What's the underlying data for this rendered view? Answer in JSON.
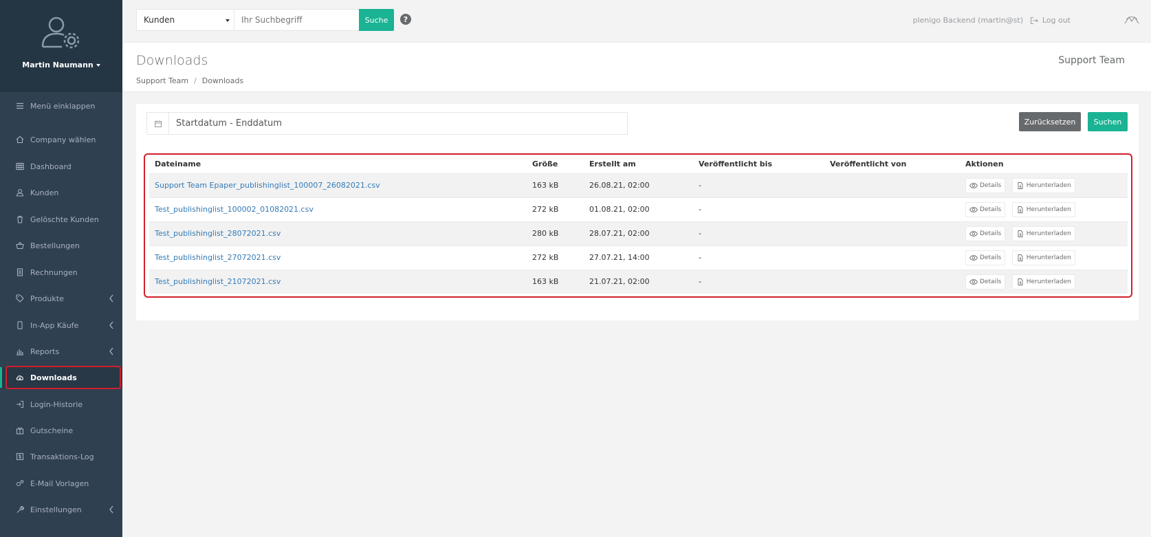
{
  "sidebar": {
    "user_name": "Martin Naumann",
    "items": [
      {
        "label": "Menü einklappen",
        "icon": "bars-icon"
      },
      {
        "label": "Company wählen",
        "icon": "home-icon"
      },
      {
        "label": "Dashboard",
        "icon": "table-icon"
      },
      {
        "label": "Kunden",
        "icon": "user-icon"
      },
      {
        "label": "Gelöschte Kunden",
        "icon": "trash-icon"
      },
      {
        "label": "Bestellungen",
        "icon": "basket-icon"
      },
      {
        "label": "Rechnungen",
        "icon": "invoice-icon"
      },
      {
        "label": "Produkte",
        "icon": "tag-icon"
      },
      {
        "label": "In-App Käufe",
        "icon": "mobile-icon"
      },
      {
        "label": "Reports",
        "icon": "bar-chart-icon"
      },
      {
        "label": "Downloads",
        "icon": "cloud-download-icon"
      },
      {
        "label": "Login-Historie",
        "icon": "sign-in-icon"
      },
      {
        "label": "Gutscheine",
        "icon": "gift-icon"
      },
      {
        "label": "Transaktions-Log",
        "icon": "dollar-icon"
      },
      {
        "label": "E-Mail Vorlagen",
        "icon": "cogs-icon"
      },
      {
        "label": "Einstellungen",
        "icon": "wrench-icon"
      }
    ]
  },
  "topbar": {
    "select_value": "Kunden",
    "search_placeholder": "Ihr Suchbegriff",
    "search_button": "Suche",
    "help": "?",
    "user_info": "plenigo Backend (martin@st)",
    "logout": "Log out"
  },
  "heading": {
    "title": "Downloads",
    "breadcrumb_1": "Support Team",
    "breadcrumb_sep": "/",
    "breadcrumb_2": "Downloads",
    "right_label": "Support Team"
  },
  "filter": {
    "date_placeholder": "Startdatum - Enddatum",
    "reset_button": "Zurücksetzen",
    "search_button": "Suchen"
  },
  "table": {
    "headers": [
      "Dateiname",
      "Größe",
      "Erstellt am",
      "Veröffentlicht bis",
      "Veröffentlicht von",
      "Aktionen"
    ],
    "details_label": "Details",
    "download_label": "Herunterladen",
    "rows": [
      {
        "name": "Support Team Epaper_publishinglist_100007_26082021.csv",
        "size": "163 kB",
        "created": "26.08.21, 02:00",
        "published_until": "-",
        "published_by": ""
      },
      {
        "name": "Test_publishinglist_100002_01082021.csv",
        "size": "272 kB",
        "created": "01.08.21, 02:00",
        "published_until": "-",
        "published_by": ""
      },
      {
        "name": "Test_publishinglist_28072021.csv",
        "size": "280 kB",
        "created": "28.07.21, 02:00",
        "published_until": "-",
        "published_by": ""
      },
      {
        "name": "Test_publishinglist_27072021.csv",
        "size": "272 kB",
        "created": "27.07.21, 14:00",
        "published_until": "-",
        "published_by": ""
      },
      {
        "name": "Test_publishinglist_21072021.csv",
        "size": "163 kB",
        "created": "21.07.21, 02:00",
        "published_until": "-",
        "published_by": ""
      }
    ]
  },
  "colors": {
    "sidebar_bg": "#2f4050",
    "accent": "#1ab394",
    "highlight": "#d21f2b",
    "link": "#337ab7"
  }
}
